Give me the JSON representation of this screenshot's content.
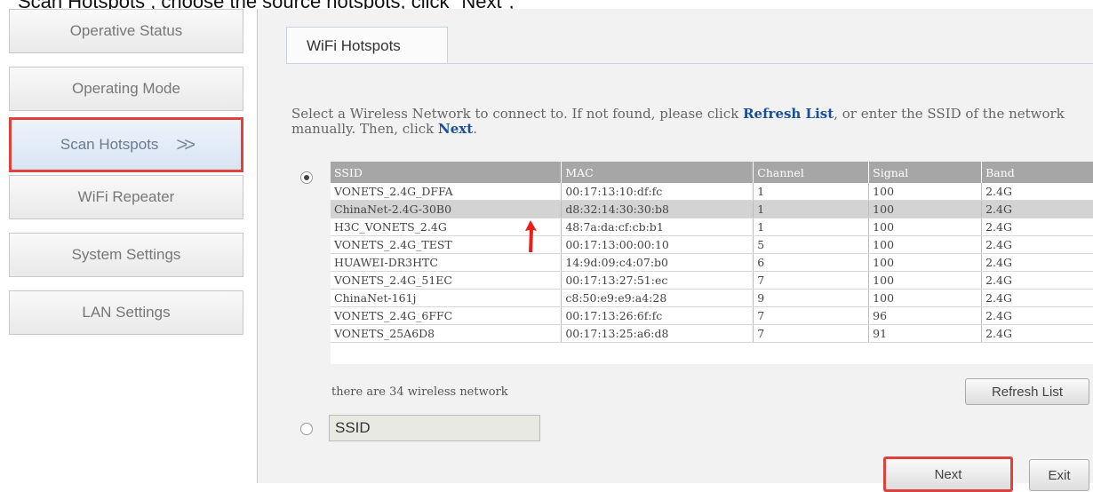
{
  "caption": "Scan Hotspots , choose the source hotspots, click \"Next\";",
  "sidebar": {
    "items": [
      {
        "label": "Operative Status"
      },
      {
        "label": "Operating Mode"
      },
      {
        "label": "Scan Hotspots",
        "active": true
      },
      {
        "label": "WiFi Repeater"
      },
      {
        "label": "System Settings"
      },
      {
        "label": "LAN Settings"
      }
    ],
    "active_chevron": ">>"
  },
  "main": {
    "tab_label": "WiFi Hotspots",
    "instructions": {
      "part1": "Select a Wireless Network to connect to. If not found, please click ",
      "refresh_link": "Refresh List",
      "part2": ", or enter the SSID of the network manually. Then, click ",
      "next_link": "Next",
      "part3": "."
    },
    "table": {
      "headers": [
        "SSID",
        "MAC",
        "Channel",
        "Signal",
        "Band"
      ],
      "rows": [
        [
          "VONETS_2.4G_DFFA",
          "00:17:13:10:df:fc",
          "1",
          "100",
          "2.4G"
        ],
        [
          "ChinaNet-2.4G-30B0",
          "d8:32:14:30:30:b8",
          "1",
          "100",
          "2.4G"
        ],
        [
          "H3C_VONETS_2.4G",
          "48:7a:da:cf:cb:b1",
          "1",
          "100",
          "2.4G"
        ],
        [
          "VONETS_2.4G_TEST",
          "00:17:13:00:00:10",
          "5",
          "100",
          "2.4G"
        ],
        [
          "HUAWEI-DR3HTC",
          "14:9d:09:c4:07:b0",
          "6",
          "100",
          "2.4G"
        ],
        [
          "VONETS_2.4G_51EC",
          "00:17:13:27:51:ec",
          "7",
          "100",
          "2.4G"
        ],
        [
          "ChinaNet-161j",
          "c8:50:e9:e9:a4:28",
          "9",
          "100",
          "2.4G"
        ],
        [
          "VONETS_2.4G_6FFC",
          "00:17:13:26:6f:fc",
          "7",
          "96",
          "2.4G"
        ],
        [
          "VONETS_25A6D8",
          "00:17:13:25:a6:d8",
          "7",
          "91",
          "2.4G"
        ]
      ],
      "selected_row": 1
    },
    "count_text": "there are 34 wireless network",
    "refresh_button": "Refresh List",
    "ssid_input_value": "SSID",
    "next_button": "Next",
    "exit_button": "Exit"
  },
  "colors": {
    "highlight_border": "#e0413d",
    "link_blue": "#1a4f9a",
    "arrow_red": "#e8201b"
  }
}
